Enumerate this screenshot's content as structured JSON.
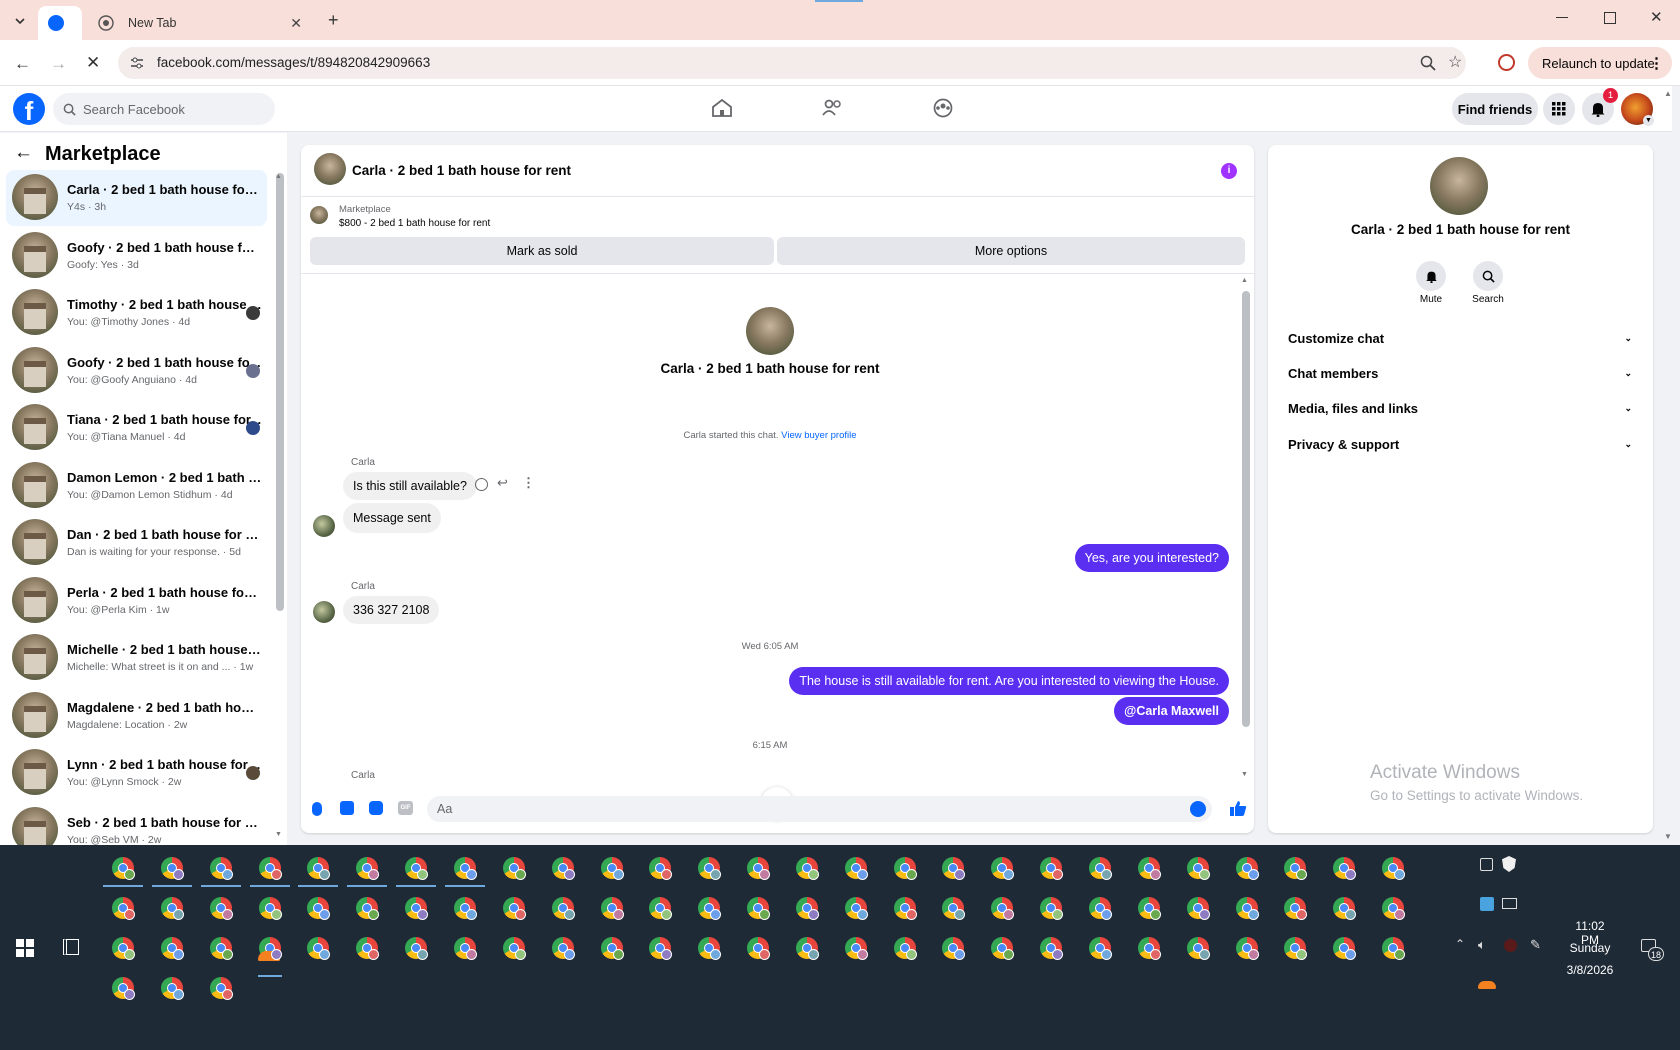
{
  "browser": {
    "tab_title": "New Tab",
    "url": "facebook.com/messages/t/894820842909663",
    "relaunch_label": "Relaunch to update"
  },
  "fb": {
    "search_placeholder": "Search Facebook",
    "find_friends": "Find friends",
    "notif_count": "1"
  },
  "left": {
    "title": "Marketplace",
    "conversations": [
      {
        "name": "Carla · 2 bed 1 bath house for re...",
        "sub": "Y4s · 3h"
      },
      {
        "name": "Goofy · 2 bed 1 bath house for r...",
        "sub": "Goofy: Yes · 3d"
      },
      {
        "name": "Timothy · 2 bed 1 bath house ...",
        "sub": "You: @Timothy Jones · 4d"
      },
      {
        "name": "Goofy · 2 bed 1 bath house fo...",
        "sub": "You: @Goofy Anguiano · 4d"
      },
      {
        "name": "Tiana · 2 bed 1 bath house for...",
        "sub": "You: @Tiana Manuel · 4d"
      },
      {
        "name": "Damon Lemon · 2 bed 1 bath h...",
        "sub": "You: @Damon Lemon Stidhum · 4d"
      },
      {
        "name": "Dan · 2 bed 1 bath house for rent",
        "sub": "Dan is waiting for your response. · 5d"
      },
      {
        "name": "Perla · 2 bed 1 bath house for re...",
        "sub": "You: @Perla Kim · 1w"
      },
      {
        "name": "Michelle · 2 bed 1 bath house fo...",
        "sub": "Michelle: What street is it on and ... · 1w"
      },
      {
        "name": "Magdalene · 2 bed 1 bath house...",
        "sub": "Magdalene: Location · 2w"
      },
      {
        "name": "Lynn · 2 bed 1 bath house for ...",
        "sub": "You: @Lynn Smock · 2w"
      },
      {
        "name": "Seb · 2 bed 1 bath house for rent",
        "sub": "You: @Seb VM · 2w"
      }
    ]
  },
  "chat": {
    "header_title": "Carla · 2 bed 1 bath house for rent",
    "marketplace_label": "Marketplace",
    "listing": "$800 - 2 bed 1 bath house for rent",
    "mark_sold": "Mark as sold",
    "more_options": "More options",
    "center_title": "Carla · 2 bed 1 bath house for rent",
    "started_text": "Carla started this chat.",
    "view_buyer": "View buyer profile",
    "sender": "Carla",
    "msg1": "Is this still available?",
    "msg2": "Message sent",
    "reply1": "Yes, are you interested?",
    "msg3": "336 327 2108",
    "time1": "Wed 6:05 AM",
    "reply2": "The house is still available for rent. Are you interested to viewing  the House.",
    "reply3": "@Carla Maxwell",
    "time2": "6:15 AM",
    "input_placeholder": "Aa"
  },
  "right": {
    "title": "Carla · 2 bed 1 bath house for rent",
    "mute": "Mute",
    "search": "Search",
    "sections": [
      "Customize chat",
      "Chat members",
      "Media, files and links",
      "Privacy & support"
    ]
  },
  "watermark": {
    "line1": "Activate Windows",
    "line2": "Go to Settings to activate Windows."
  },
  "taskbar": {
    "time": "11:02 PM",
    "day": "Sunday",
    "date": "3/8/2026",
    "notif_badge": "18"
  },
  "colors": {
    "fb_blue": "#0866ff",
    "messenger_purple": "#5b2ff2",
    "taskbar": "#1f2a37"
  }
}
